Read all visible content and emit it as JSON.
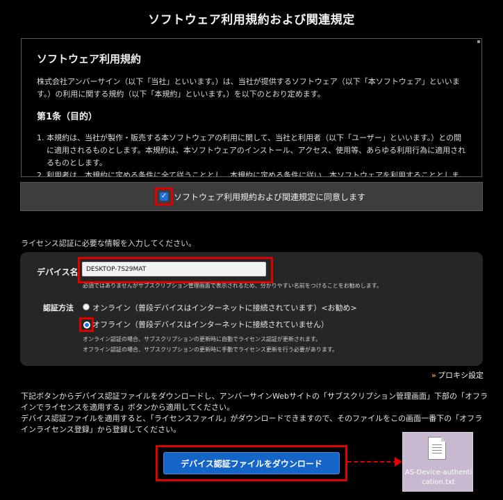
{
  "page": {
    "title": "ソフトウェア利用規約および関連規定"
  },
  "terms": {
    "heading": "ソフトウェア利用規約",
    "intro": "株式会社アンバーサイン（以下「当社」といいます。）は、当社が提供するソフトウェア（以下「本ソフトウェア」といいます。）の利用に関する規約（以下「本規約」といいます。）を以下のとおり定めます。",
    "article_title": "第1条（目的）",
    "items": [
      "本規約は、当社が製作・販売する本ソフトウェアの利用に関して、当社と利用者（以下「ユーザー」といいます。）との間に適用されるものとします。本規約は、本ソフトウェアのインストール、アクセス、使用等、あらゆる利用行為に適用されるものとします。",
      "利用者は、本規約に定める条件に全て従うこととし、本規約に定める条件に従い、本ソフトウェアを利用することとします。"
    ]
  },
  "agree": {
    "label": "ソフトウェア利用規約および関連規定に同意します",
    "checked": true
  },
  "license": {
    "prompt": "ライセンス認証に必要な情報を入力してください。",
    "device_label": "デバイス名",
    "device_value": "DESKTOP-7S29MAT",
    "device_note": "必須ではありませんがサブスクリプション管理画面で表示されるため、分かりやすい名前をつけることをお勧めします。",
    "auth_label": "認証方法",
    "online_label": "オンライン（普段デバイスはインターネットに接続されています）<お勧め>",
    "offline_label": "オフライン（普段デバイスはインターネットに接続されていません）",
    "selected": "offline",
    "auth_note_1": "オンライン認証の場合、サブスクリプションの更新時に自動でライセンス認証が更新されます。",
    "auth_note_2": "オフライン認証の場合、サブスクリプションの更新時に手動でライセンス更新を行う必要があります。"
  },
  "proxy": {
    "chevron": "»",
    "label": "プロキシ設定"
  },
  "instructions": {
    "para1": "下記ボタンからデバイス認証ファイルをダウンロードし、アンバーサインWebサイトの「サブスクリプション管理画面」下部の「オフラインでライセンスを適用する」ボタンから適用してください。",
    "para2": "デバイス認証ファイルを適用すると、「ライセンスファイル」がダウンロードできますので、そのファイルをこの画面一番下の「オフラインライセンス登録」から登録してください。"
  },
  "download": {
    "label": "デバイス認証ファイルをダウンロード"
  },
  "file": {
    "name": "AS-Device-authentication.txt",
    "icon": "text-file-icon"
  },
  "colors": {
    "highlight": "#e00000",
    "accent": "#1565c8",
    "proxy_chevron": "#f0a030"
  }
}
